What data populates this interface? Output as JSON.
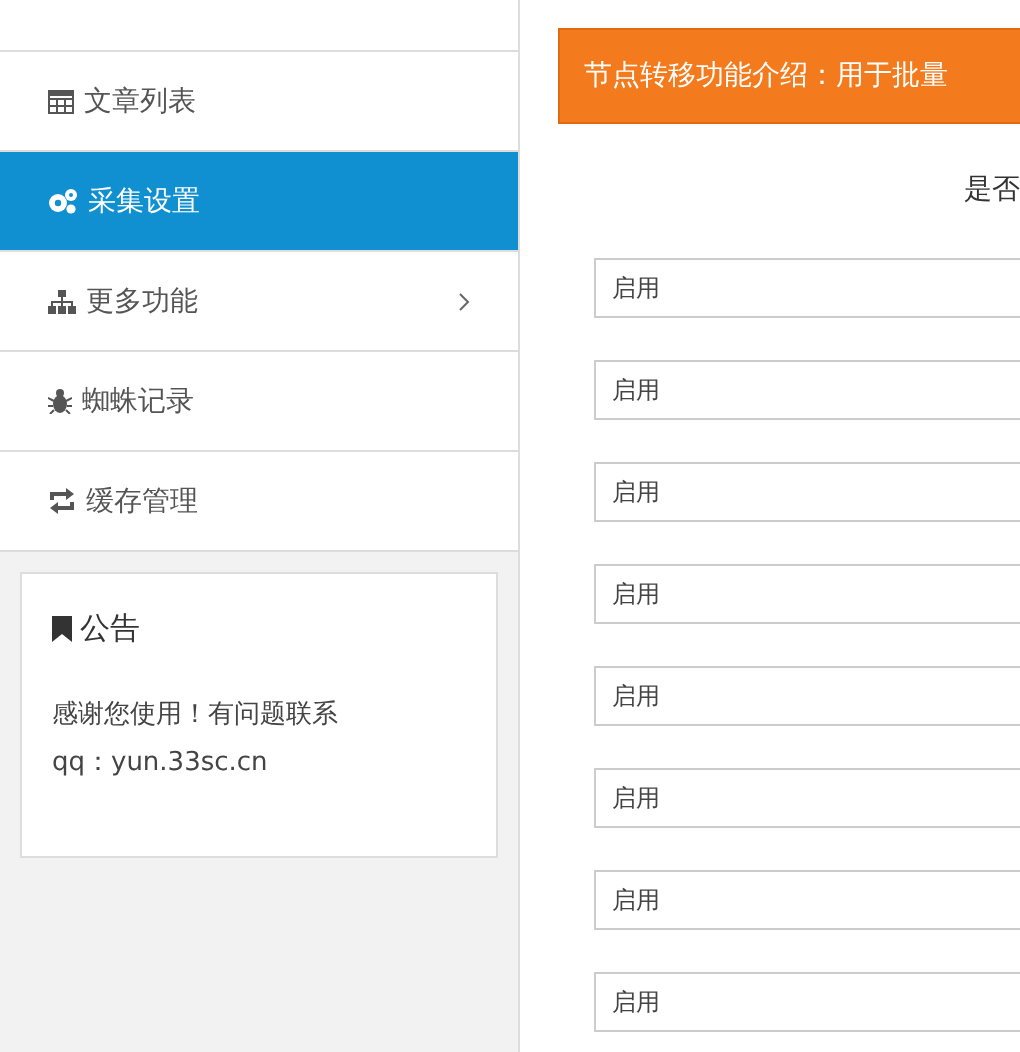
{
  "sidebar": {
    "items": [
      {
        "label": "文章列表",
        "selected": false,
        "has_children": false
      },
      {
        "label": "采集设置",
        "selected": true,
        "has_children": false
      },
      {
        "label": "更多功能",
        "selected": false,
        "has_children": true
      },
      {
        "label": "蜘蛛记录",
        "selected": false,
        "has_children": false
      },
      {
        "label": "缓存管理",
        "selected": false,
        "has_children": false
      }
    ],
    "notice": {
      "title": "公告",
      "lines": [
        "感谢您使用！有问题联系",
        "qq：yun.33sc.cn"
      ]
    }
  },
  "main": {
    "banner": "节点转移功能介绍：用于批量",
    "question": "是否",
    "fields": [
      {
        "value": "启用"
      },
      {
        "value": "启用"
      },
      {
        "value": "启用"
      },
      {
        "value": "启用"
      },
      {
        "value": "启用"
      },
      {
        "value": "启用"
      },
      {
        "value": "启用"
      },
      {
        "value": "启用"
      }
    ]
  }
}
